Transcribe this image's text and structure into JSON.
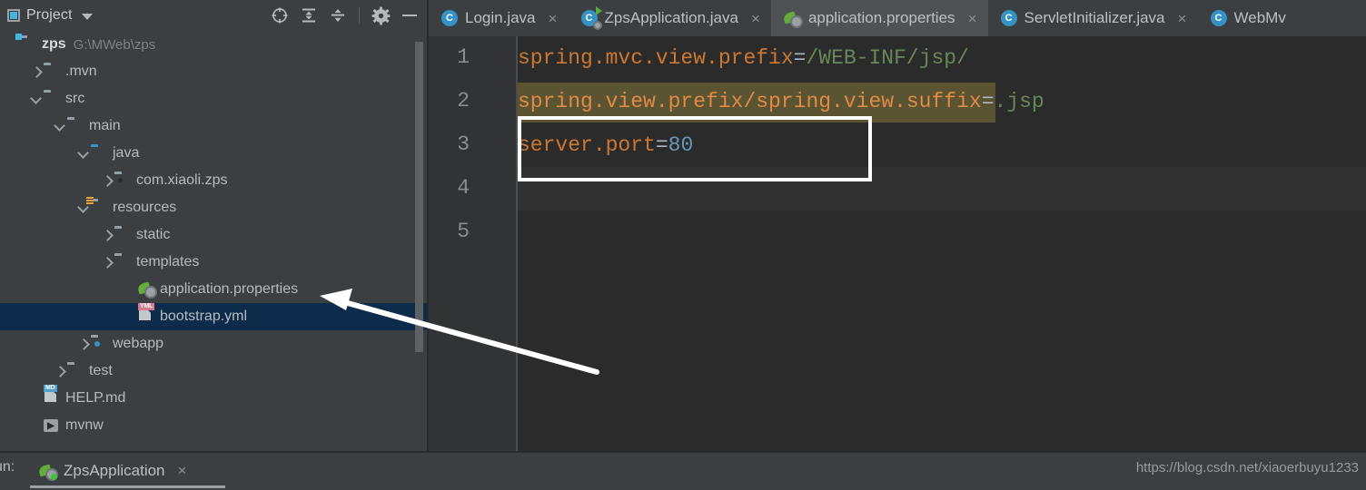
{
  "sidebar": {
    "tab_label": "Project",
    "tab_icon": "project-panel-icon",
    "dropdown_icon": "chevron-down-icon",
    "tools": [
      {
        "name": "locate-icon",
        "title": "Select Opened File"
      },
      {
        "name": "expand-all-icon",
        "title": "Expand All"
      },
      {
        "name": "collapse-all-icon",
        "title": "Collapse All"
      },
      {
        "name": "gear-icon",
        "title": "Settings"
      },
      {
        "name": "minimize-icon",
        "title": "Hide"
      }
    ],
    "tree": [
      {
        "label": "zps",
        "sub": "G:\\MWeb\\zps",
        "icon": "folder-module-icon",
        "indent": 0,
        "chevron": "",
        "bold": true,
        "selected": false
      },
      {
        "label": ".mvn",
        "sub": "",
        "icon": "folder-icon",
        "indent": 1,
        "chevron": "closed",
        "bold": false,
        "selected": false
      },
      {
        "label": "src",
        "sub": "",
        "icon": "folder-icon",
        "indent": 1,
        "chevron": "open",
        "bold": false,
        "selected": false
      },
      {
        "label": "main",
        "sub": "",
        "icon": "folder-icon",
        "indent": 2,
        "chevron": "open",
        "bold": false,
        "selected": false
      },
      {
        "label": "java",
        "sub": "",
        "icon": "folder-source-icon",
        "indent": 3,
        "chevron": "open",
        "bold": false,
        "selected": false
      },
      {
        "label": "com.xiaoli.zps",
        "sub": "",
        "icon": "folder-package-icon",
        "indent": 4,
        "chevron": "closed",
        "bold": false,
        "selected": false
      },
      {
        "label": "resources",
        "sub": "",
        "icon": "folder-resources-icon",
        "indent": 3,
        "chevron": "open",
        "bold": false,
        "selected": false
      },
      {
        "label": "static",
        "sub": "",
        "icon": "folder-icon",
        "indent": 4,
        "chevron": "closed",
        "bold": false,
        "selected": false
      },
      {
        "label": "templates",
        "sub": "",
        "icon": "folder-icon",
        "indent": 4,
        "chevron": "closed",
        "bold": false,
        "selected": false
      },
      {
        "label": "application.properties",
        "sub": "",
        "icon": "spring-properties-icon",
        "indent": 5,
        "chevron": "",
        "bold": false,
        "selected": false
      },
      {
        "label": "bootstrap.yml",
        "sub": "",
        "icon": "yml-file-icon",
        "indent": 5,
        "chevron": "",
        "bold": false,
        "selected": true
      },
      {
        "label": "webapp",
        "sub": "",
        "icon": "folder-webapp-icon",
        "indent": 3,
        "chevron": "closed",
        "bold": false,
        "selected": false
      },
      {
        "label": "test",
        "sub": "",
        "icon": "folder-icon",
        "indent": 2,
        "chevron": "closed",
        "bold": false,
        "selected": false
      },
      {
        "label": "HELP.md",
        "sub": "",
        "icon": "md-file-icon",
        "indent": 1,
        "chevron": "",
        "bold": false,
        "selected": false
      },
      {
        "label": "mvnw",
        "sub": "",
        "icon": "terminal-script-icon",
        "indent": 1,
        "chevron": "",
        "bold": false,
        "selected": false
      }
    ]
  },
  "editor": {
    "tabs": [
      {
        "title": "Login.java",
        "icon": "java-class-icon",
        "active": false,
        "closable": true
      },
      {
        "title": "ZpsApplication.java",
        "icon": "java-runnable-class-icon",
        "active": false,
        "closable": true
      },
      {
        "title": "application.properties",
        "icon": "spring-properties-icon",
        "active": true,
        "closable": true
      },
      {
        "title": "ServletInitializer.java",
        "icon": "java-class-icon",
        "active": false,
        "closable": true
      },
      {
        "title": "WebMv",
        "icon": "java-class-icon",
        "active": false,
        "closable": false
      }
    ],
    "line_numbers": [
      "1",
      "2",
      "3",
      "4",
      "5"
    ],
    "lines": [
      {
        "n": 1,
        "key": "spring.mvc.view.prefix",
        "eq": "=",
        "value": "/WEB-INF/jsp/",
        "value_kind": "string",
        "highlight": false
      },
      {
        "n": 2,
        "key": "spring.view.prefix/spring.view.suffix",
        "eq": "=",
        "value": ".jsp",
        "value_kind": "string",
        "highlight": true
      },
      {
        "n": 3,
        "key": "server.port",
        "eq": "=",
        "value": "80",
        "value_kind": "number",
        "highlight": false
      },
      {
        "n": 4,
        "key": "",
        "eq": "",
        "value": "",
        "value_kind": "empty",
        "highlight": false
      },
      {
        "n": 5,
        "key": "",
        "eq": "",
        "value": "",
        "value_kind": "empty",
        "highlight": false
      }
    ],
    "colors": {
      "background": "#2b2b2b",
      "gutter": "#313335",
      "key": "#cc7832",
      "key_alt": "#e08a45",
      "string": "#6a8759",
      "number": "#6897bb",
      "operator": "#a9b7c6",
      "warn_highlight": "#5b5433",
      "caret_line": "#323232"
    }
  },
  "annotations": {
    "box_label": "highlight-box-server-port",
    "arrow_label": "arrow-to-application-properties",
    "color": "#ffffff"
  },
  "bottom": {
    "run_label": "un:",
    "run_tab_title": "ZpsApplication",
    "run_tab_icon": "spring-run-icon",
    "run_tab_close": "×",
    "watermark": "https://blog.csdn.net/xiaoerbuyu1233"
  }
}
